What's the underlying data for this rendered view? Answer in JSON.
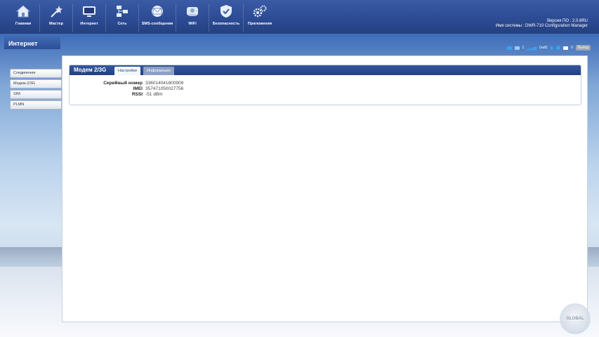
{
  "nav": {
    "items": [
      {
        "label": "Главная",
        "icon": "home-icon"
      },
      {
        "label": "Мастер",
        "icon": "wizard-icon"
      },
      {
        "label": "Интернет",
        "icon": "internet-icon"
      },
      {
        "label": "Сеть",
        "icon": "network-icon"
      },
      {
        "label": "SMS-сообщения",
        "icon": "envelope-icon"
      },
      {
        "label": "WiFi",
        "icon": "wifi-icon"
      },
      {
        "label": "Безопасность",
        "icon": "shield-icon"
      },
      {
        "label": "Приложения",
        "icon": "gears-icon"
      }
    ]
  },
  "system": {
    "version_line": "Версия ПО : 2.0.8RU",
    "name_line": "Имя системы : DWR-710 Configuration Manager"
  },
  "section_title": "Интернет",
  "status": {
    "count1": "1",
    "signal_text": "(null)",
    "count2": "0",
    "logout": "Выход"
  },
  "sidebar": {
    "items": [
      {
        "label": "Соединение"
      },
      {
        "label": "Модем 2/3G"
      },
      {
        "label": "SIM"
      },
      {
        "label": "PLMN"
      }
    ]
  },
  "card": {
    "title": "Модем 2/3G",
    "tabs": [
      {
        "label": "Настройки"
      },
      {
        "label": "Информация"
      }
    ],
    "rows": [
      {
        "key": "Серийный номер",
        "value": "336014041800909"
      },
      {
        "key": "IMEI",
        "value": "357471050027756"
      },
      {
        "key": "RSSI",
        "value": "-51 dBm"
      }
    ]
  },
  "colors": {
    "header": "#2b4a92",
    "accent": "#3aa0f0"
  }
}
